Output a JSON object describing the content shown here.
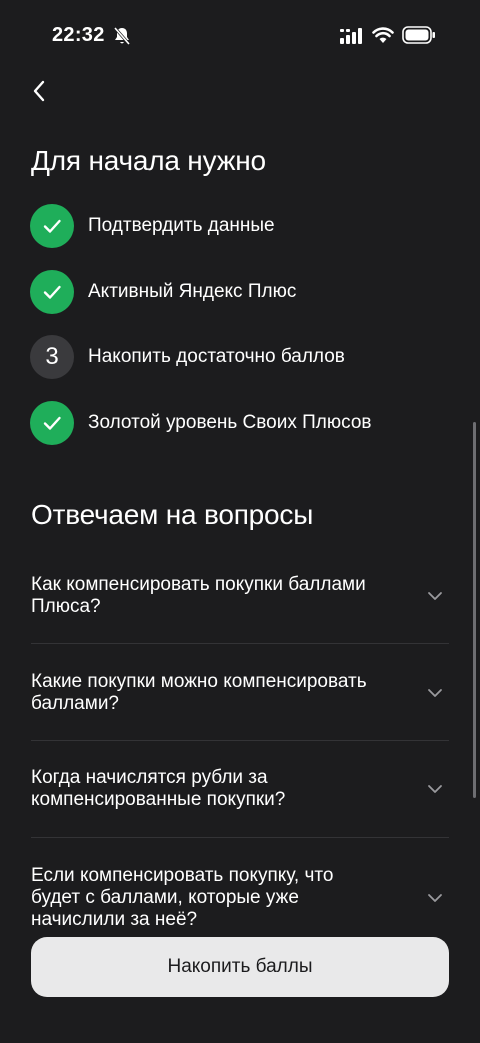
{
  "status_bar": {
    "time": "22:32",
    "icons": [
      "bell-slash-icon",
      "signal-icon",
      "wifi-icon",
      "battery-icon"
    ]
  },
  "nav": {
    "back_icon": "chevron-left-icon"
  },
  "requirements": {
    "title": "Для начала нужно",
    "items": [
      {
        "label": "Подтвердить данные",
        "state": "done",
        "icon": "check-icon"
      },
      {
        "label": "Активный Яндекс Плюс",
        "state": "done",
        "icon": "check-icon"
      },
      {
        "label": "Накопить достаточно баллов",
        "state": "pending",
        "number": "3"
      },
      {
        "label": "Золотой уровень Своих Плюсов",
        "state": "done",
        "icon": "check-icon"
      }
    ]
  },
  "faq": {
    "title": "Отвечаем на вопросы",
    "items": [
      {
        "question": "Как компенсировать покупки баллами Плюса?"
      },
      {
        "question": "Какие покупки можно компенсировать баллами?"
      },
      {
        "question": "Когда начислятся рубли за компенсированные покупки?"
      },
      {
        "question": "Если компенсировать покупку, что будет с баллами, которые уже начислили за неё?"
      }
    ]
  },
  "action": {
    "label": "Накопить баллы"
  },
  "colors": {
    "background": "#1c1c1e",
    "success": "#1fae5a",
    "pending_badge": "#3a3a3d",
    "button_bg": "#e9e9ea",
    "button_text": "#1c1c1e"
  }
}
